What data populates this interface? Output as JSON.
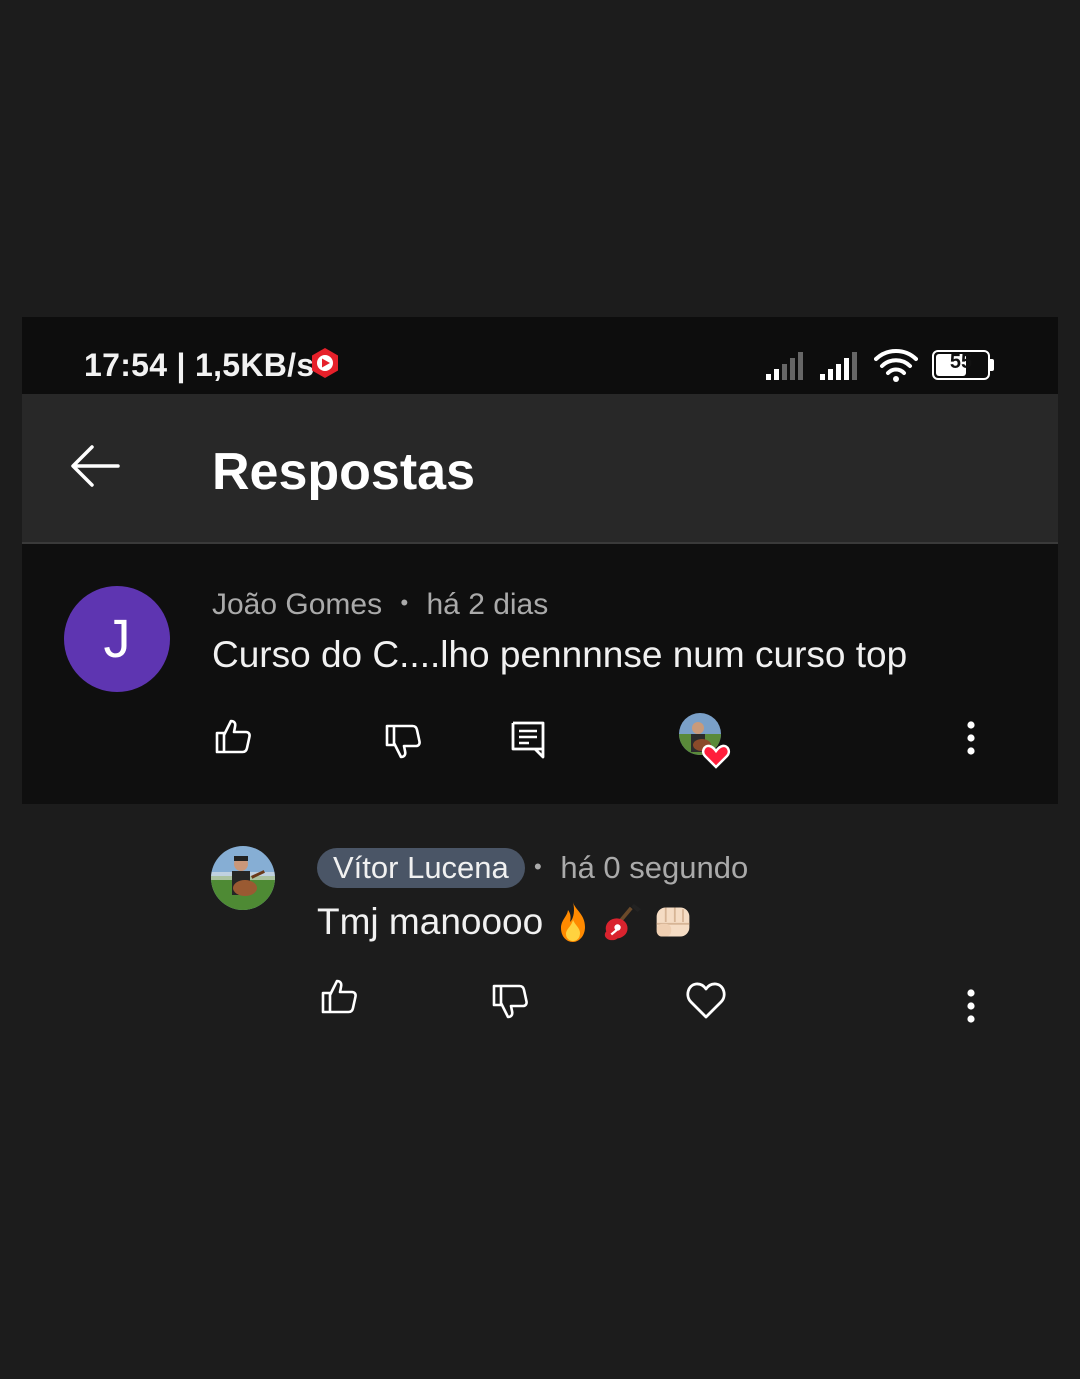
{
  "status_bar": {
    "time_speed": "17:54 | 1,5KB/s",
    "battery": "55",
    "icons": [
      "screen-record-icon",
      "signal-icon",
      "signal-icon",
      "wifi-icon",
      "battery-icon"
    ]
  },
  "header": {
    "title": "Respostas",
    "back_icon": "arrow-left-icon"
  },
  "comment": {
    "avatar_letter": "J",
    "author": "João Gomes",
    "separator": "•",
    "time": "há 2 dias",
    "text": "Curso do C....lho pennnnse num curso top",
    "actions": [
      "like-icon",
      "dislike-icon",
      "reply-icon",
      "creator-heart-icon",
      "more-icon"
    ]
  },
  "reply": {
    "author": "Vítor Lucena",
    "separator": "•",
    "time": "há 0 segundo",
    "text": "Tmj manoooo",
    "emojis": [
      "fire-icon",
      "guitar-icon",
      "fist-icon"
    ],
    "actions": [
      "like-icon",
      "dislike-icon",
      "heart-icon",
      "more-icon"
    ]
  },
  "colors": {
    "avatar_purple": "#5e35b1",
    "author_chip": "#4a5566",
    "heart_red": "#ff1e3c",
    "record_red": "#e6202a"
  }
}
